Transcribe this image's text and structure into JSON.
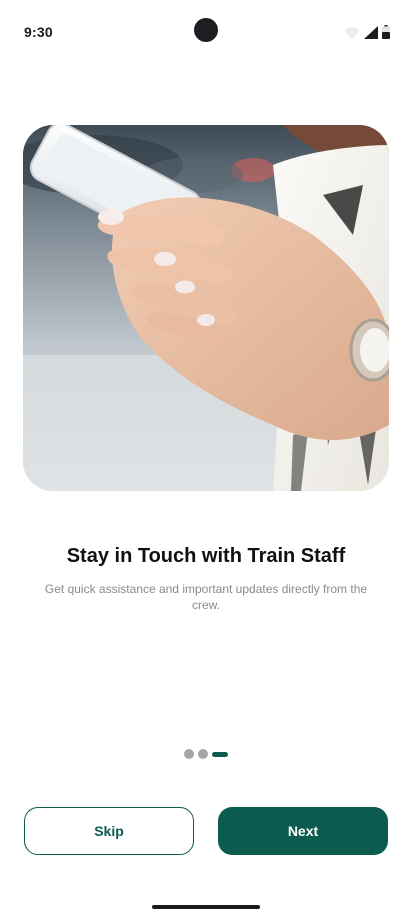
{
  "status_bar": {
    "time": "9:30",
    "icons": [
      "wifi-icon",
      "cellular-signal-icon",
      "battery-icon"
    ]
  },
  "hero": {
    "image": "hand-holding-smartphone-photo"
  },
  "onboarding": {
    "title": "Stay in Touch with Train Staff",
    "subtitle": "Get quick assistance and important updates directly from the crew.",
    "page_indicator": {
      "total": 3,
      "current": 3
    }
  },
  "actions": {
    "skip_label": "Skip",
    "next_label": "Next"
  },
  "colors": {
    "primary": "#0b5c4e",
    "dot_inactive": "#a5a5a5",
    "subtitle_text": "#8a8a8a"
  }
}
